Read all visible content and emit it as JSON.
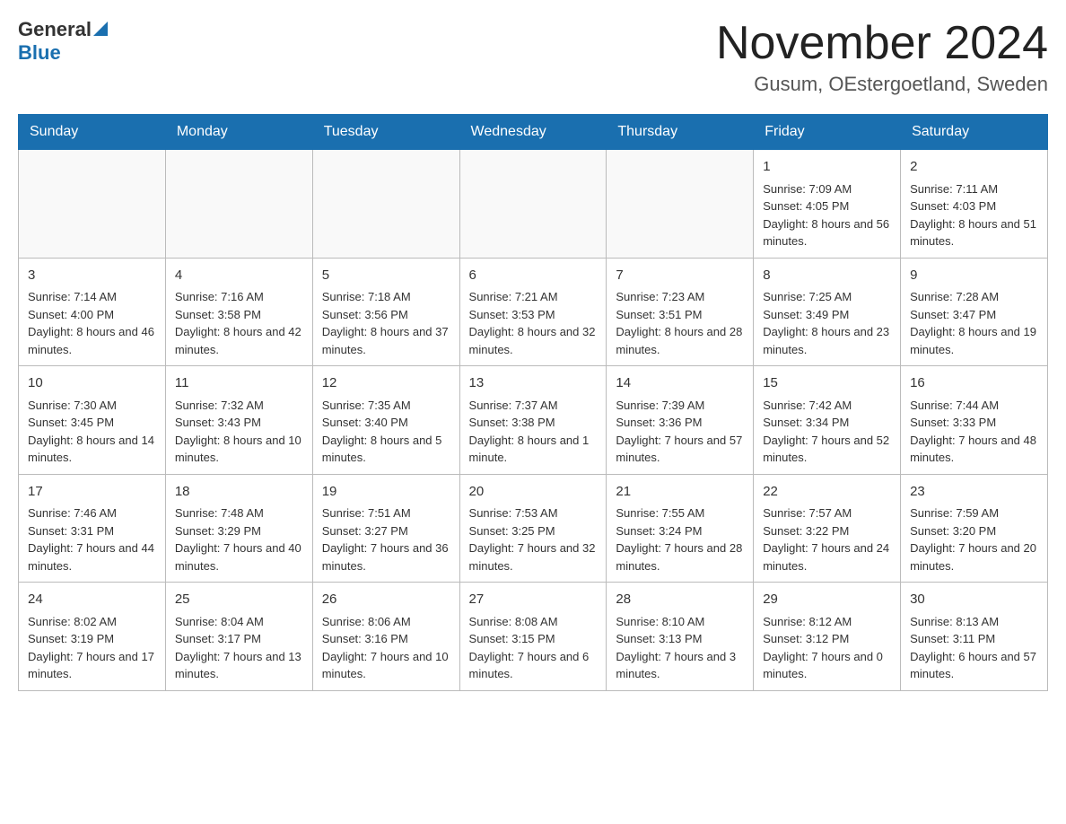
{
  "header": {
    "logo_line1": "General",
    "logo_line2": "Blue",
    "calendar_title": "November 2024",
    "calendar_subtitle": "Gusum, OEstergoetland, Sweden"
  },
  "days_of_week": [
    "Sunday",
    "Monday",
    "Tuesday",
    "Wednesday",
    "Thursday",
    "Friday",
    "Saturday"
  ],
  "weeks": [
    {
      "days": [
        {
          "number": "",
          "info": ""
        },
        {
          "number": "",
          "info": ""
        },
        {
          "number": "",
          "info": ""
        },
        {
          "number": "",
          "info": ""
        },
        {
          "number": "",
          "info": ""
        },
        {
          "number": "1",
          "info": "Sunrise: 7:09 AM\nSunset: 4:05 PM\nDaylight: 8 hours and 56 minutes."
        },
        {
          "number": "2",
          "info": "Sunrise: 7:11 AM\nSunset: 4:03 PM\nDaylight: 8 hours and 51 minutes."
        }
      ]
    },
    {
      "days": [
        {
          "number": "3",
          "info": "Sunrise: 7:14 AM\nSunset: 4:00 PM\nDaylight: 8 hours and 46 minutes."
        },
        {
          "number": "4",
          "info": "Sunrise: 7:16 AM\nSunset: 3:58 PM\nDaylight: 8 hours and 42 minutes."
        },
        {
          "number": "5",
          "info": "Sunrise: 7:18 AM\nSunset: 3:56 PM\nDaylight: 8 hours and 37 minutes."
        },
        {
          "number": "6",
          "info": "Sunrise: 7:21 AM\nSunset: 3:53 PM\nDaylight: 8 hours and 32 minutes."
        },
        {
          "number": "7",
          "info": "Sunrise: 7:23 AM\nSunset: 3:51 PM\nDaylight: 8 hours and 28 minutes."
        },
        {
          "number": "8",
          "info": "Sunrise: 7:25 AM\nSunset: 3:49 PM\nDaylight: 8 hours and 23 minutes."
        },
        {
          "number": "9",
          "info": "Sunrise: 7:28 AM\nSunset: 3:47 PM\nDaylight: 8 hours and 19 minutes."
        }
      ]
    },
    {
      "days": [
        {
          "number": "10",
          "info": "Sunrise: 7:30 AM\nSunset: 3:45 PM\nDaylight: 8 hours and 14 minutes."
        },
        {
          "number": "11",
          "info": "Sunrise: 7:32 AM\nSunset: 3:43 PM\nDaylight: 8 hours and 10 minutes."
        },
        {
          "number": "12",
          "info": "Sunrise: 7:35 AM\nSunset: 3:40 PM\nDaylight: 8 hours and 5 minutes."
        },
        {
          "number": "13",
          "info": "Sunrise: 7:37 AM\nSunset: 3:38 PM\nDaylight: 8 hours and 1 minute."
        },
        {
          "number": "14",
          "info": "Sunrise: 7:39 AM\nSunset: 3:36 PM\nDaylight: 7 hours and 57 minutes."
        },
        {
          "number": "15",
          "info": "Sunrise: 7:42 AM\nSunset: 3:34 PM\nDaylight: 7 hours and 52 minutes."
        },
        {
          "number": "16",
          "info": "Sunrise: 7:44 AM\nSunset: 3:33 PM\nDaylight: 7 hours and 48 minutes."
        }
      ]
    },
    {
      "days": [
        {
          "number": "17",
          "info": "Sunrise: 7:46 AM\nSunset: 3:31 PM\nDaylight: 7 hours and 44 minutes."
        },
        {
          "number": "18",
          "info": "Sunrise: 7:48 AM\nSunset: 3:29 PM\nDaylight: 7 hours and 40 minutes."
        },
        {
          "number": "19",
          "info": "Sunrise: 7:51 AM\nSunset: 3:27 PM\nDaylight: 7 hours and 36 minutes."
        },
        {
          "number": "20",
          "info": "Sunrise: 7:53 AM\nSunset: 3:25 PM\nDaylight: 7 hours and 32 minutes."
        },
        {
          "number": "21",
          "info": "Sunrise: 7:55 AM\nSunset: 3:24 PM\nDaylight: 7 hours and 28 minutes."
        },
        {
          "number": "22",
          "info": "Sunrise: 7:57 AM\nSunset: 3:22 PM\nDaylight: 7 hours and 24 minutes."
        },
        {
          "number": "23",
          "info": "Sunrise: 7:59 AM\nSunset: 3:20 PM\nDaylight: 7 hours and 20 minutes."
        }
      ]
    },
    {
      "days": [
        {
          "number": "24",
          "info": "Sunrise: 8:02 AM\nSunset: 3:19 PM\nDaylight: 7 hours and 17 minutes."
        },
        {
          "number": "25",
          "info": "Sunrise: 8:04 AM\nSunset: 3:17 PM\nDaylight: 7 hours and 13 minutes."
        },
        {
          "number": "26",
          "info": "Sunrise: 8:06 AM\nSunset: 3:16 PM\nDaylight: 7 hours and 10 minutes."
        },
        {
          "number": "27",
          "info": "Sunrise: 8:08 AM\nSunset: 3:15 PM\nDaylight: 7 hours and 6 minutes."
        },
        {
          "number": "28",
          "info": "Sunrise: 8:10 AM\nSunset: 3:13 PM\nDaylight: 7 hours and 3 minutes."
        },
        {
          "number": "29",
          "info": "Sunrise: 8:12 AM\nSunset: 3:12 PM\nDaylight: 7 hours and 0 minutes."
        },
        {
          "number": "30",
          "info": "Sunrise: 8:13 AM\nSunset: 3:11 PM\nDaylight: 6 hours and 57 minutes."
        }
      ]
    }
  ]
}
